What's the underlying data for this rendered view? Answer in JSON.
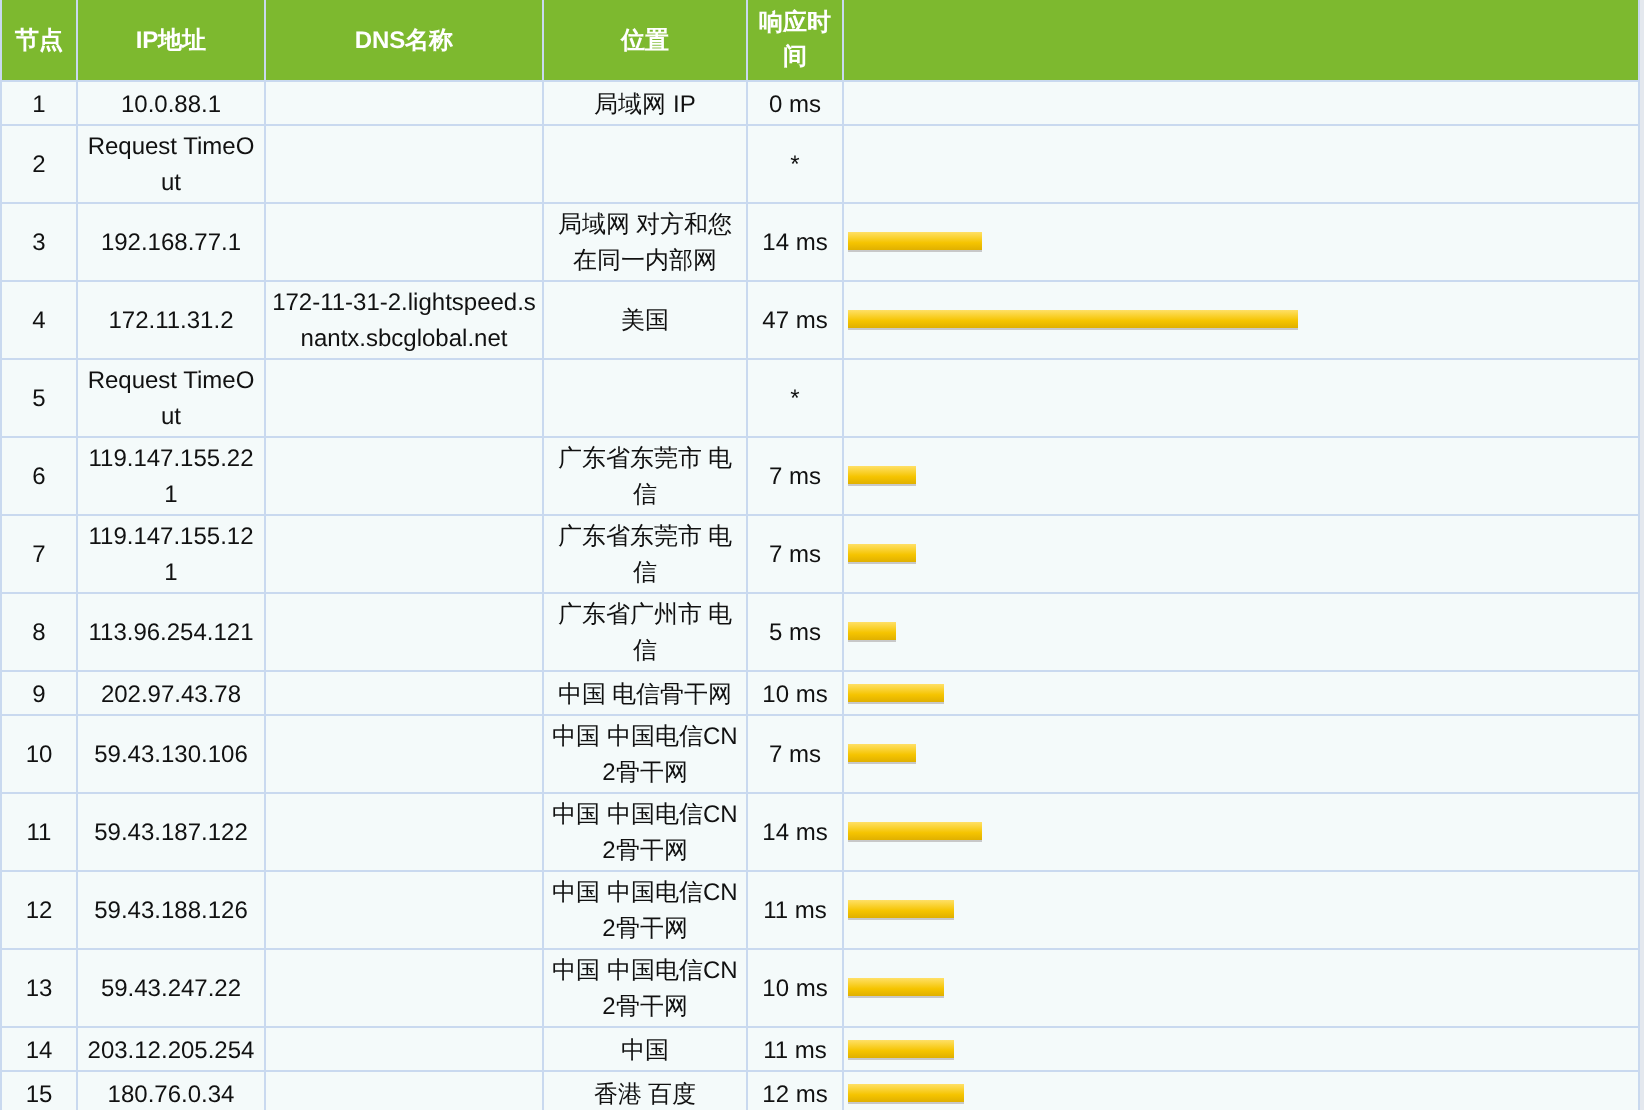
{
  "table": {
    "columns": [
      "节点",
      "IP地址",
      "DNS名称",
      "位置",
      "响应时间"
    ],
    "rows": [
      {
        "hop": "1",
        "ip": "10.0.88.1",
        "location": "局域网 IP",
        "time": "0 ms"
      },
      {
        "hop": "2",
        "ip": "Request TimeOut",
        "time": "*"
      },
      {
        "hop": "3",
        "ip": "192.168.77.1",
        "location": "局域网 对方和您在同一内部网",
        "time": "14 ms",
        "level": 0.172
      },
      {
        "hop": "4",
        "ip": "172.11.31.2",
        "dns": "172-11-31-2.lightspeed.snantx.sbcglobal.net",
        "location": "美国",
        "time": "47 ms",
        "level": 0.578
      },
      {
        "hop": "5",
        "ip": "Request TimeOut",
        "time": "*"
      },
      {
        "hop": "6",
        "ip": "119.147.155.221",
        "location": "广东省东莞市 电信",
        "time": "7 ms",
        "level": 0.086
      },
      {
        "hop": "7",
        "ip": "119.147.155.121",
        "location": "广东省东莞市 电信",
        "time": "7 ms",
        "level": 0.086
      },
      {
        "hop": "8",
        "ip": "113.96.254.121",
        "location": "广东省广州市 电信",
        "time": "5 ms",
        "level": 0.062
      },
      {
        "hop": "9",
        "ip": "202.97.43.78",
        "location": "中国 电信骨干网",
        "time": "10 ms",
        "level": 0.123
      },
      {
        "hop": "10",
        "ip": "59.43.130.106",
        "location": "中国 中国电信CN2骨干网",
        "time": "7 ms",
        "level": 0.086
      },
      {
        "hop": "11",
        "ip": "59.43.187.122",
        "location": "中国 中国电信CN2骨干网",
        "time": "14 ms",
        "level": 0.172
      },
      {
        "hop": "12",
        "ip": "59.43.188.126",
        "location": "中国 中国电信CN2骨干网",
        "time": "11 ms",
        "level": 0.135
      },
      {
        "hop": "13",
        "ip": "59.43.247.22",
        "location": "中国 中国电信CN2骨干网",
        "time": "10 ms",
        "level": 0.123
      },
      {
        "hop": "14",
        "ip": "203.12.205.254",
        "location": "中国",
        "time": "11 ms",
        "level": 0.135
      },
      {
        "hop": "15",
        "ip": "180.76.0.34",
        "location": "香港 百度",
        "time": "12 ms",
        "level": 0.148
      }
    ]
  }
}
